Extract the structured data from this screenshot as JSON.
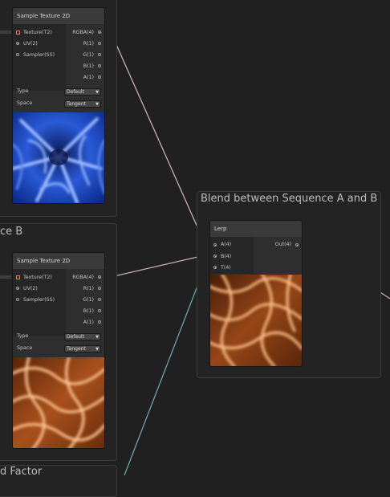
{
  "groups": {
    "blend_title": "Blend between Sequence A and B",
    "seq_b_title_fragment": "ce B",
    "factor_title_fragment": "d Factor"
  },
  "node_top": {
    "title": "Sample Texture 2D",
    "inputs": [
      "Texture(T2)",
      "UV(2)",
      "Sampler(SS)"
    ],
    "outputs": [
      "RGBA(4)",
      "R(1)",
      "G(1)",
      "B(1)",
      "A(1)"
    ],
    "type_label": "Type",
    "type_value": "Default",
    "space_label": "Space",
    "space_value": "Tangent"
  },
  "node_bottom": {
    "title": "Sample Texture 2D",
    "inputs": [
      "Texture(T2)",
      "UV(2)",
      "Sampler(SS)"
    ],
    "outputs": [
      "RGBA(4)",
      "R(1)",
      "G(1)",
      "B(1)",
      "A(1)"
    ],
    "type_label": "Type",
    "type_value": "Default",
    "space_label": "Space",
    "space_value": "Tangent"
  },
  "lerp": {
    "title": "Lerp",
    "inputs": [
      "A(4)",
      "B(4)",
      "T(4)"
    ],
    "output": "Out(4)"
  },
  "colors": {
    "background": "#202020",
    "wire": "#c8aeb8",
    "wire_teal": "#6fa3ad",
    "texture_port": "#e08060"
  }
}
